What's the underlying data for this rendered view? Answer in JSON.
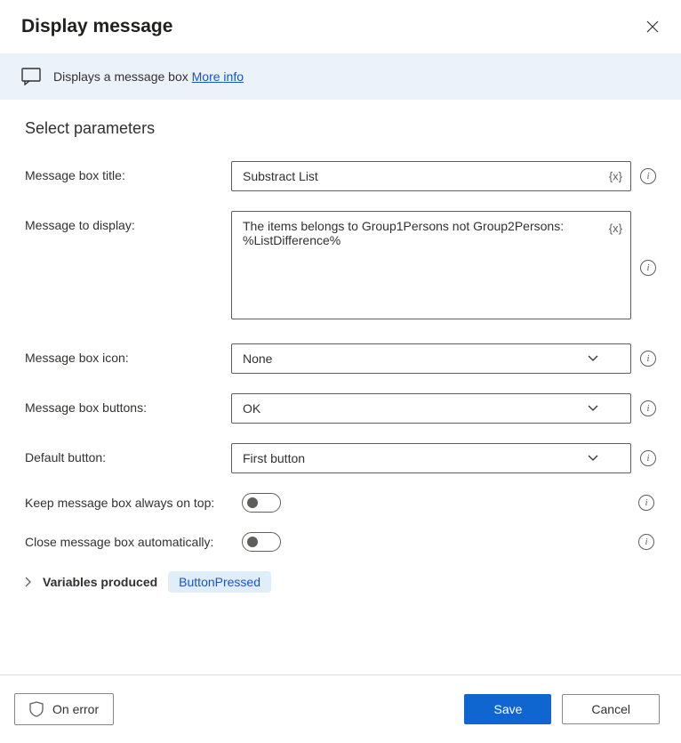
{
  "header": {
    "title": "Display message"
  },
  "banner": {
    "text": "Displays a message box ",
    "link": "More info"
  },
  "section_title": "Select parameters",
  "fields": {
    "title": {
      "label": "Message box title:",
      "value": "Substract List"
    },
    "message": {
      "label": "Message to display:",
      "value": "The items belongs to Group1Persons not Group2Persons: %ListDifference%"
    },
    "icon": {
      "label": "Message box icon:",
      "value": "None"
    },
    "buttons": {
      "label": "Message box buttons:",
      "value": "OK"
    },
    "default_btn": {
      "label": "Default button:",
      "value": "First button"
    },
    "on_top": {
      "label": "Keep message box always on top:"
    },
    "auto_close": {
      "label": "Close message box automatically:"
    }
  },
  "variables": {
    "label": "Variables produced",
    "chip": "ButtonPressed"
  },
  "footer": {
    "on_error": "On error",
    "save": "Save",
    "cancel": "Cancel"
  },
  "badge": "{x}"
}
